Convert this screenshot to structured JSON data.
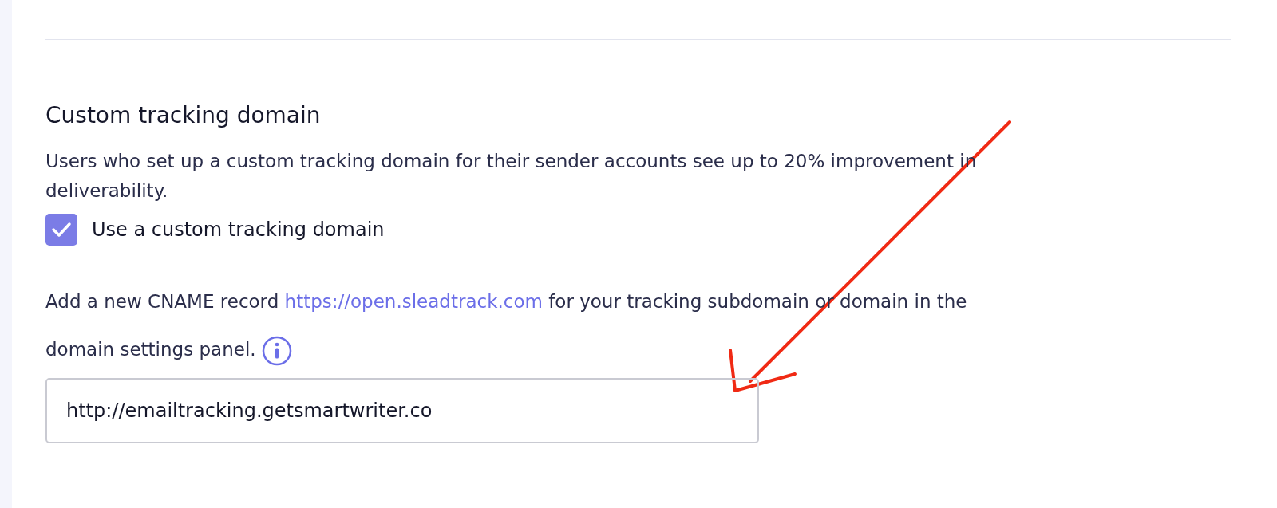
{
  "section": {
    "title": "Custom tracking domain",
    "description": "Users who set up a custom tracking domain for their sender accounts see up to 20% improvement in deliverability.",
    "checkbox": {
      "label": "Use a custom tracking domain",
      "checked": true
    },
    "instructions": {
      "before": "Add a new CNAME record",
      "link": "https://open.sleadtrack.com",
      "after": "for your tracking subdomain or domain in the domain settings panel."
    },
    "field": {
      "value": "http://emailtracking.getsmartwriter.co"
    }
  }
}
